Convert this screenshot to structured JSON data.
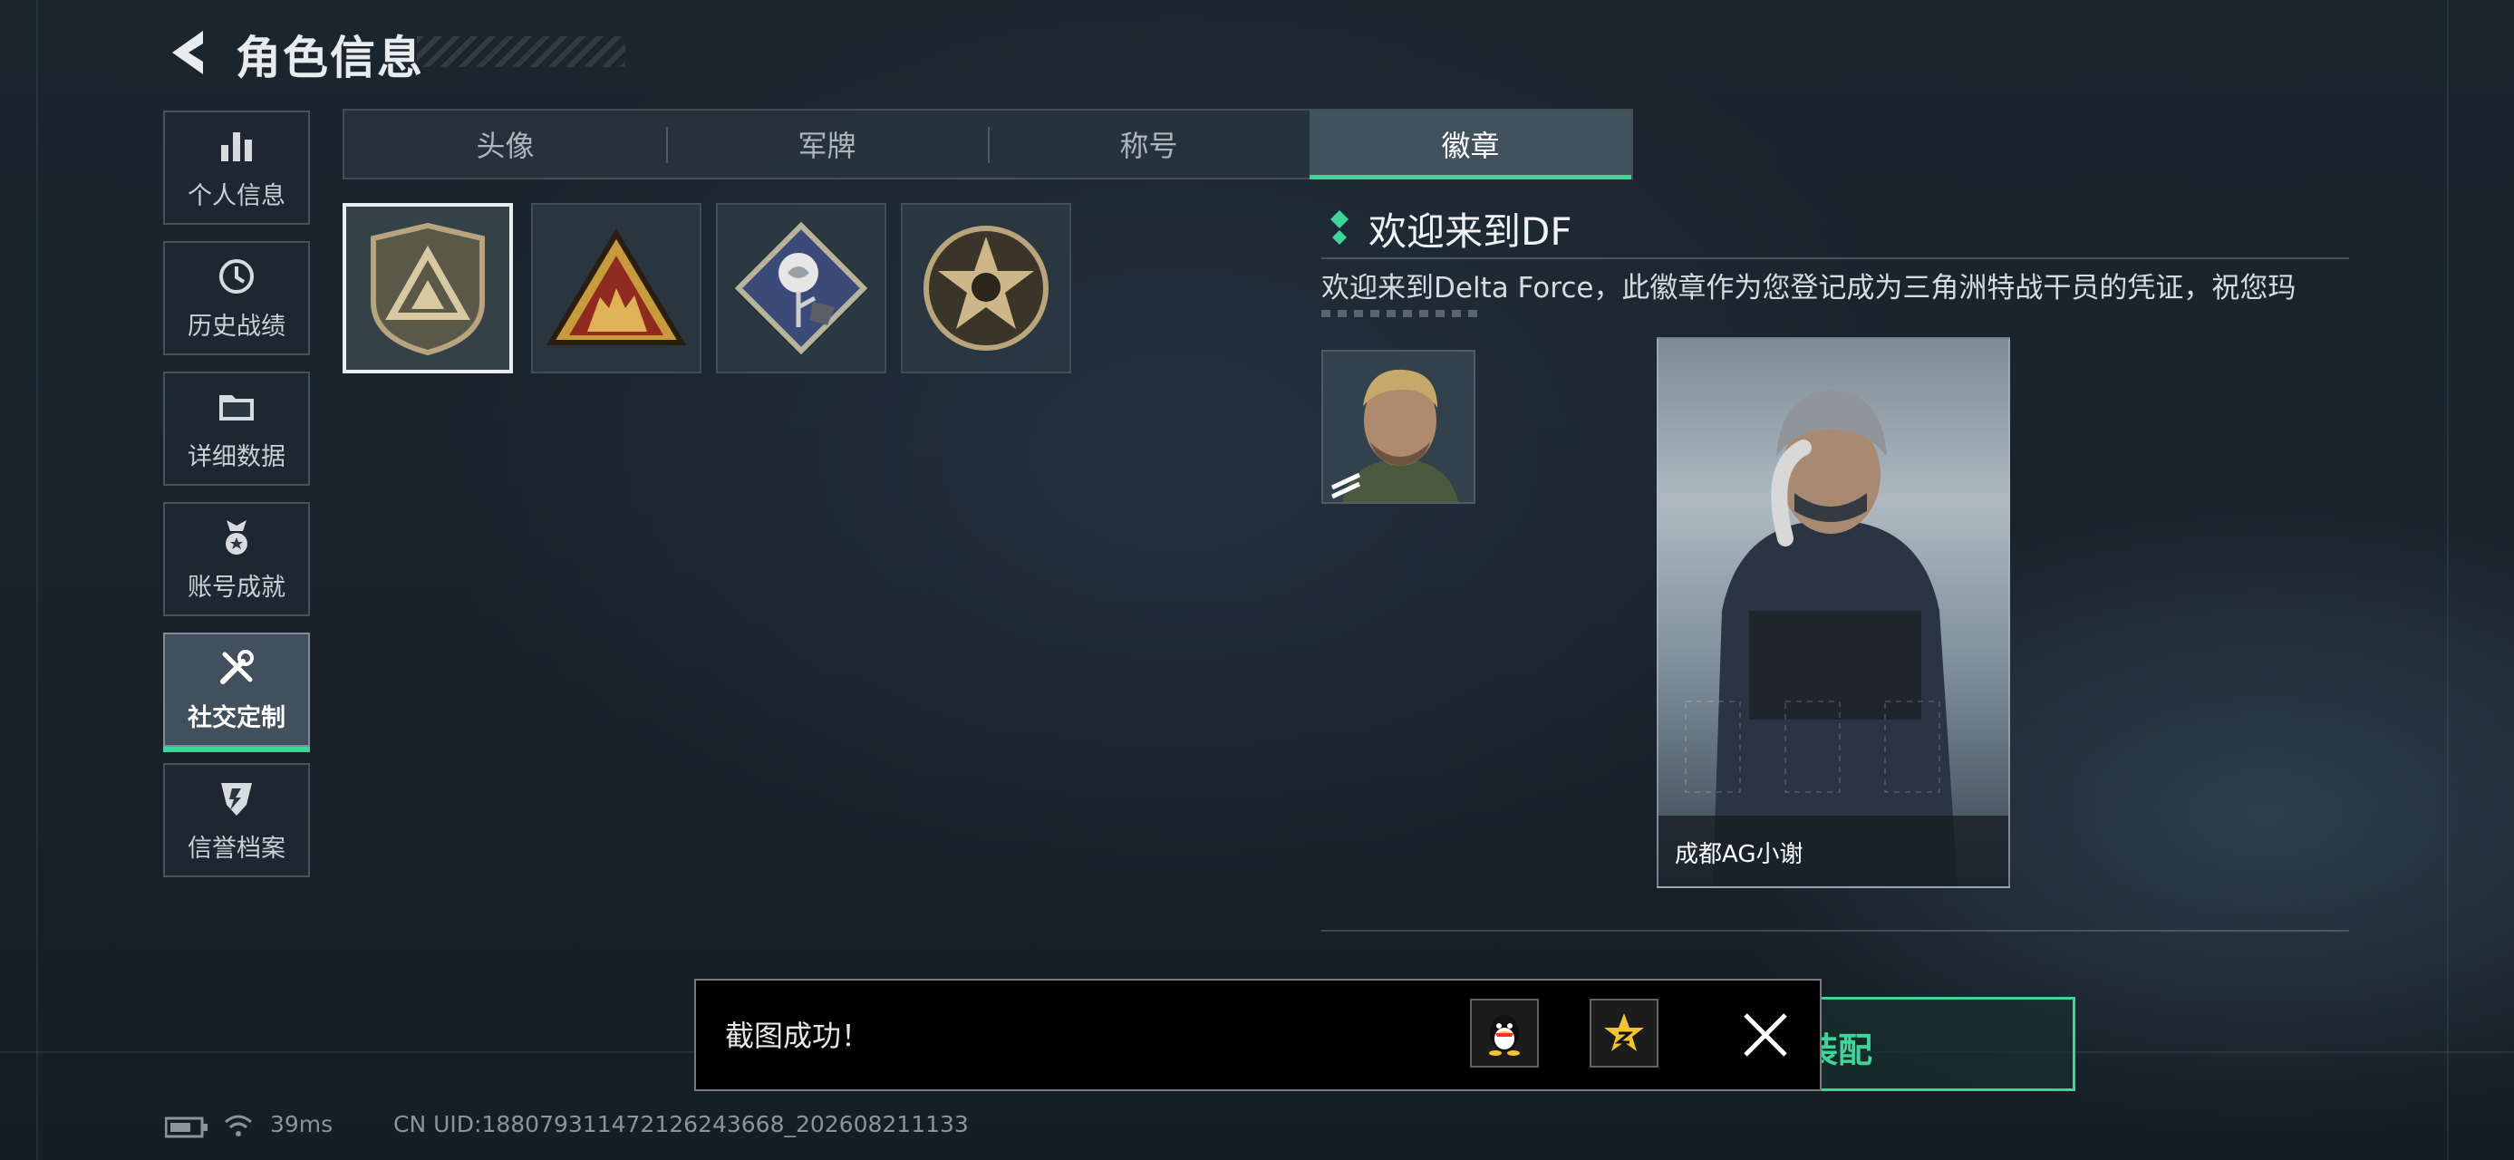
{
  "header": {
    "title": "角色信息"
  },
  "sidebar": {
    "items": [
      {
        "label": "个人信息",
        "icon": "bar-chart-icon"
      },
      {
        "label": "历史战绩",
        "icon": "clock-icon"
      },
      {
        "label": "详细数据",
        "icon": "folder-icon"
      },
      {
        "label": "账号成就",
        "icon": "medal-icon"
      },
      {
        "label": "社交定制",
        "icon": "tools-icon",
        "active": true
      },
      {
        "label": "信誉档案",
        "icon": "shield-badge-icon"
      }
    ]
  },
  "tabs": [
    {
      "label": "头像"
    },
    {
      "label": "军牌"
    },
    {
      "label": "称号"
    },
    {
      "label": "徽章",
      "active": true
    }
  ],
  "badges": [
    {
      "name": "delta-triangle-badge",
      "selected": true
    },
    {
      "name": "squad-triangle-badge"
    },
    {
      "name": "rose-diamond-badge"
    },
    {
      "name": "skull-star-badge"
    }
  ],
  "detail": {
    "title": "欢迎来到DF",
    "description": "欢迎来到Delta Force，此徽章作为您登记成为三角洲特战干员的凭证，祝您玛"
  },
  "character": {
    "name": "成都AG小谢"
  },
  "equip_button": {
    "label": "装配"
  },
  "toast": {
    "message": "截图成功！",
    "share_targets": [
      "qq-icon",
      "qzone-icon"
    ]
  },
  "status_bar": {
    "ping": "39ms",
    "uid": "CN UID:1880793114721262436​68_202608211133"
  },
  "colors": {
    "accent": "#3fd59a",
    "background": "#1a232c"
  }
}
